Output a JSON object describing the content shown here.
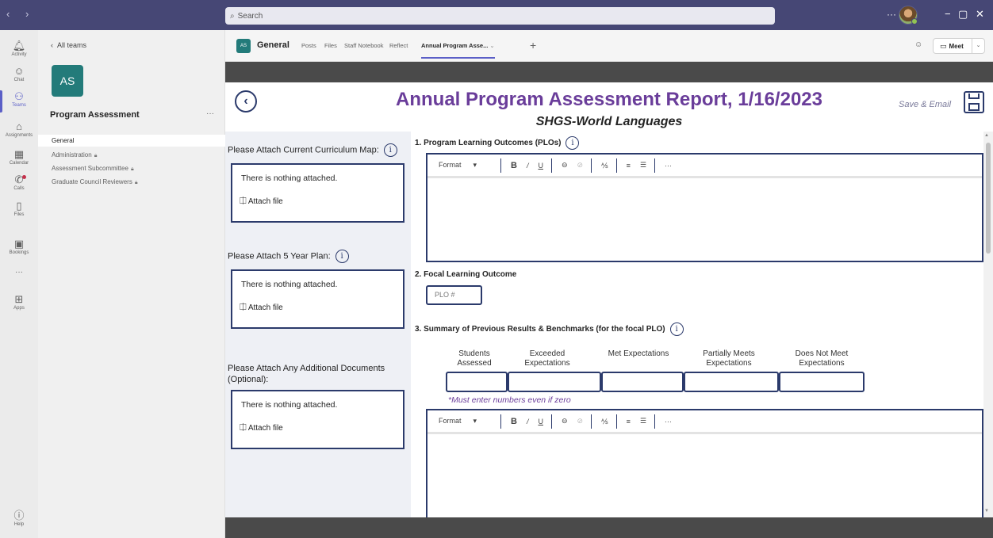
{
  "titlebar": {
    "nav": "‹ ›",
    "search_placeholder": "Search",
    "more": "···",
    "minimize": "−",
    "restore": "▢",
    "close": "✕"
  },
  "rail": {
    "items": [
      {
        "label": "Activity",
        "icon": "bell-icon"
      },
      {
        "label": "Chat",
        "icon": "chat-icon"
      },
      {
        "label": "Teams",
        "icon": "teams-icon"
      },
      {
        "label": "Assignments",
        "icon": "assignments-icon"
      },
      {
        "label": "Calendar",
        "icon": "calendar-icon"
      },
      {
        "label": "Calls",
        "icon": "phone-icon"
      },
      {
        "label": "Files",
        "icon": "file-icon"
      },
      {
        "label": "Bookings",
        "icon": "bookings-icon"
      },
      {
        "label": "···",
        "icon": "more-icon"
      },
      {
        "label": "Apps",
        "icon": "apps-icon"
      },
      {
        "label": "Help",
        "icon": "help-icon"
      }
    ]
  },
  "sidebar": {
    "back_label": "All teams",
    "team_initials": "AS",
    "team_name": "Program Assessment",
    "team_more": "···",
    "channels": [
      {
        "label": "General"
      },
      {
        "label": "Administration"
      },
      {
        "label": "Assessment Subcommittee"
      },
      {
        "label": "Graduate Council Reviewers"
      }
    ]
  },
  "channel_header": {
    "initials": "AS",
    "name": "General",
    "tabs": [
      "Posts",
      "Files",
      "Staff Notebook",
      "Reflect",
      "Annual Program Asse..."
    ],
    "meet_label": "Meet"
  },
  "app": {
    "title": "Annual Program Assessment Report, 1/16/2023",
    "subtitle": "SHGS-World Languages",
    "save_label": "Save & Email",
    "attach_curriculum_label": "Please Attach Current Curriculum Map:",
    "attach_plan_label": "Please Attach 5 Year Plan:",
    "attach_additional_label": "Please Attach Any Additional Documents (Optional):",
    "nothing_attached": "There is nothing attached.",
    "attach_file": "Attach file",
    "section1_label": "1. Program Learning Outcomes (PLOs)",
    "section2_label": "2. Focal Learning Outcome",
    "plo_placeholder": "PLO #",
    "section3_label": "3. Summary of Previous Results & Benchmarks (for the focal PLO)",
    "bench_headers": [
      "Students Assessed",
      "Exceeded Expectations",
      "Met Expectations",
      "Partially Meets Expectations",
      "Does Not Meet Expectations"
    ],
    "bench_note": "*Must enter numbers even if zero",
    "rte_format": "Format",
    "info_glyph": "i"
  }
}
